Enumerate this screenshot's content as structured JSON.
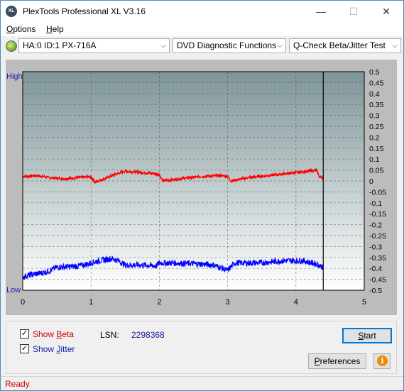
{
  "window": {
    "title": "PlexTools Professional XL V3.16",
    "icon_text": "XL"
  },
  "titlebar_buttons": {
    "minimize": "—",
    "maximize": "☐",
    "close": "✕"
  },
  "menu": [
    {
      "label_accel": "O",
      "label_rest": "ptions"
    },
    {
      "label_accel": "H",
      "label_rest": "elp"
    }
  ],
  "toolbar": {
    "drive": "HA:0 ID:1  PX-716A",
    "function": "DVD Diagnostic Functions",
    "test": "Q-Check Beta/Jitter Test"
  },
  "chart_data": {
    "type": "line",
    "xlim": [
      0,
      5
    ],
    "ylim": [
      -0.5,
      0.5
    ],
    "x_ticks": [
      "0",
      "1",
      "2",
      "3",
      "4",
      "5"
    ],
    "y_ticks": [
      "0.5",
      "0.45",
      "0.4",
      "0.35",
      "0.3",
      "0.25",
      "0.2",
      "0.15",
      "0.1",
      "0.05",
      "0",
      "-0.05",
      "-0.1",
      "-0.15",
      "-0.2",
      "-0.25",
      "-0.3",
      "-0.35",
      "-0.4",
      "-0.45",
      "-0.5"
    ],
    "left_labels": {
      "top": "High",
      "bottom": "Low"
    },
    "end_marker_x": 4.4,
    "series": [
      {
        "color": "#ff0000",
        "x": [
          0,
          0.2,
          0.4,
          0.6,
          0.8,
          1.0,
          1.05,
          1.2,
          1.35,
          1.5,
          1.7,
          1.9,
          2.0,
          2.05,
          2.3,
          2.6,
          2.9,
          3.0,
          3.05,
          3.3,
          3.6,
          3.9,
          4.2,
          4.3,
          4.35,
          4.4
        ],
        "y": [
          0.02,
          0.025,
          0.015,
          0.01,
          0.015,
          0.02,
          -0.005,
          0.01,
          0.03,
          0.045,
          0.04,
          0.035,
          0.03,
          0.0,
          0.01,
          0.02,
          0.025,
          0.02,
          0.0,
          0.015,
          0.025,
          0.035,
          0.045,
          0.05,
          0.015,
          0.02
        ]
      },
      {
        "color": "#0000ff",
        "x": [
          0,
          0.1,
          0.3,
          0.4,
          0.5,
          0.8,
          0.95,
          1.0,
          1.05,
          1.3,
          1.4,
          1.5,
          1.8,
          1.95,
          2.0,
          2.2,
          2.6,
          2.8,
          3.0,
          3.1,
          3.5,
          3.8,
          4.1,
          4.3,
          4.4
        ],
        "y": [
          -0.44,
          -0.43,
          -0.42,
          -0.41,
          -0.395,
          -0.39,
          -0.38,
          -0.375,
          -0.37,
          -0.355,
          -0.365,
          -0.385,
          -0.385,
          -0.39,
          -0.375,
          -0.375,
          -0.38,
          -0.385,
          -0.41,
          -0.375,
          -0.375,
          -0.365,
          -0.365,
          -0.38,
          -0.395
        ]
      }
    ]
  },
  "bottom": {
    "show_beta_accel": "B",
    "show_beta_pre": "Show ",
    "show_beta_post": "eta",
    "show_jitter_accel": "J",
    "show_jitter_pre": "Show ",
    "show_jitter_post": "itter",
    "lsn_label": "LSN:",
    "lsn_value": "2298368",
    "start_accel": "S",
    "start_rest": "tart",
    "preferences_accel": "P",
    "preferences_rest": "references",
    "check_mark": "✓",
    "info_glyph": "i"
  },
  "status": {
    "text": "Ready"
  },
  "colors": {
    "beta": "#cc0000",
    "jitter": "#1a1ab0",
    "plot_top": "#7e9598",
    "plot_bottom": "#ffffff"
  }
}
